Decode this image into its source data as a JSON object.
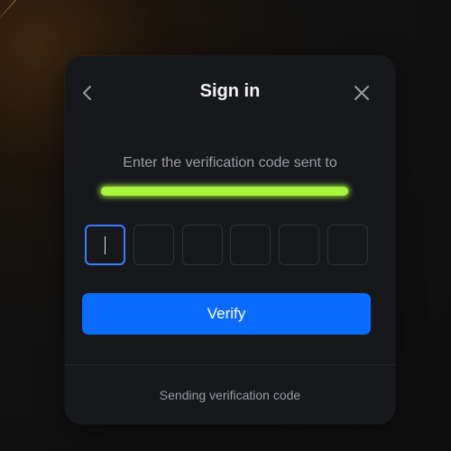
{
  "dialog": {
    "title": "Sign in",
    "back_icon": "chevron-left-icon",
    "close_icon": "close-icon",
    "subtitle": "Enter the verification code sent to",
    "email_redacted": true,
    "code_length": 6,
    "code_values": [
      "",
      "",
      "",
      "",
      "",
      ""
    ],
    "verify_label": "Verify",
    "status_text": "Sending verification code"
  },
  "colors": {
    "accent": "#0a6cff",
    "focus_border": "#3a7bff",
    "redaction": "#a7f53c",
    "modal_bg": "#17181c"
  }
}
